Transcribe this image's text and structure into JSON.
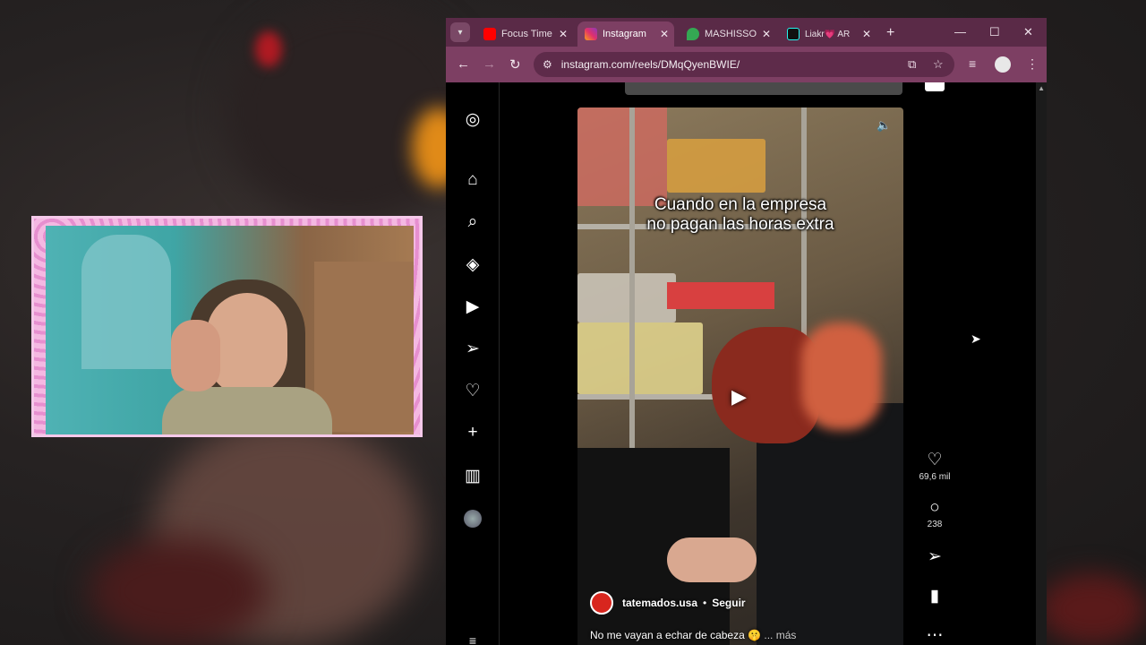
{
  "browser": {
    "tabs": [
      {
        "label": "Focus Time",
        "favicon": "youtube-icon",
        "color": "#ff0000"
      },
      {
        "label": "Instagram",
        "favicon": "instagram-icon",
        "color": "#e1306c"
      },
      {
        "label": "MASHISSO",
        "favicon": "maps-pin-icon",
        "color": "#34a853"
      },
      {
        "label": "Liakr💗 AR",
        "favicon": "tiktok-icon",
        "color": "#111111"
      }
    ],
    "url": "instagram.com/reels/DMqQyenBWIE/",
    "accent": "#7d3f63"
  },
  "reel": {
    "caption_overlay_line1": "Cuando en la empresa",
    "caption_overlay_line2": "no pagan las horas extra",
    "owner": "tatemados.usa",
    "separator": "•",
    "follow_label": "Seguir",
    "description": "No me vayan a echar de cabeza 🤫",
    "more_label": "... más"
  },
  "actions": {
    "likes": "69,6 mil",
    "comments": "238"
  }
}
